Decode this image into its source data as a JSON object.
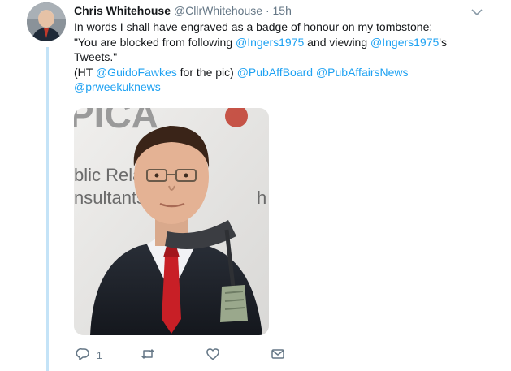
{
  "tweet": {
    "author_name": "Chris Whitehouse",
    "handle": "@CllrWhitehouse",
    "separator": "·",
    "time": "15h",
    "line1": "In words I shall have engraved as a badge of honour on my tombstone:",
    "line2_a": "\"You are blocked from following ",
    "mention_1": "@Ingers1975",
    "line2_b": " and viewing ",
    "mention_2": "@Ingers1975",
    "line2_c": "'s",
    "line3": "Tweets.\"",
    "line4_a": "(HT ",
    "mention_3": "@GuidoFawkes",
    "line4_b": " for the pic) ",
    "mention_4": "@PubAffBoard",
    "mention_5": "@PubAffairsNews",
    "mention_6": "@prweekuknews",
    "image_text": {
      "top": "PICA",
      "line_a": "blic Relat",
      "line_b": "nsultants",
      "side": "h"
    }
  },
  "actions": {
    "reply_count": "1"
  },
  "colors": {
    "link": "#1da1f2",
    "muted": "#657786",
    "thread_line": "#c4e3f7"
  },
  "icons": [
    "chevron-down-icon",
    "reply-icon",
    "retweet-icon",
    "like-icon",
    "dm-icon"
  ]
}
